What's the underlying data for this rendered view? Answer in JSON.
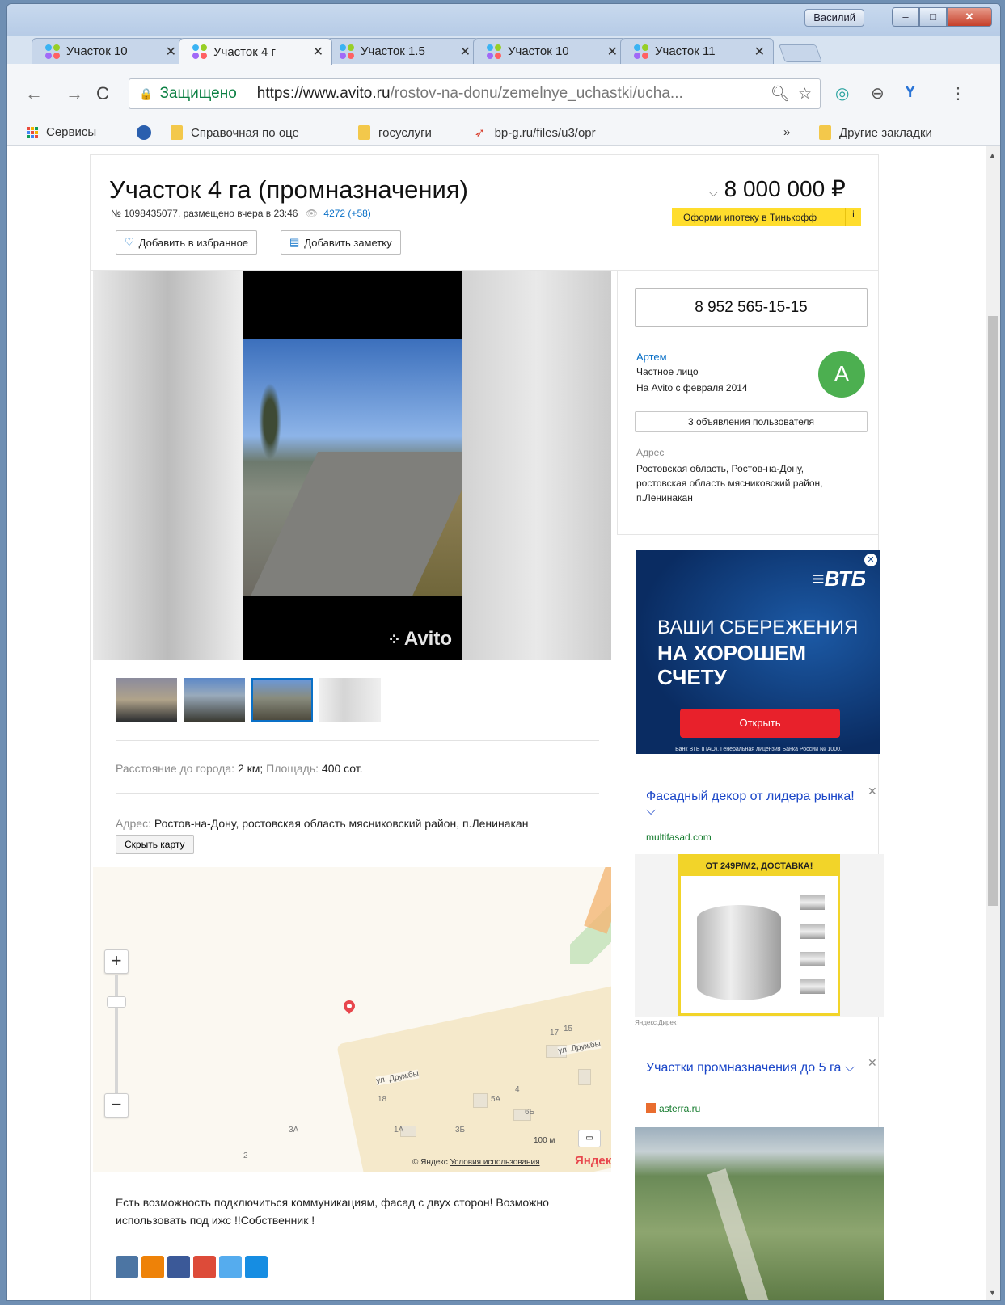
{
  "window": {
    "profile_name": "Василий"
  },
  "tabs": [
    {
      "title": "Участок 10"
    },
    {
      "title": "Участок 4 г",
      "active": true
    },
    {
      "title": "Участок 1.5"
    },
    {
      "title": "Участок 10"
    },
    {
      "title": "Участок 11"
    }
  ],
  "address_bar": {
    "secure_label": "Защищено",
    "url_host": "https://www.avito.ru",
    "url_path": "/rostov-na-donu/zemelnye_uchastki/ucha..."
  },
  "bookmarks": {
    "apps_label": "Сервисы",
    "items": [
      "Справочная по оце",
      "госуслуги",
      "bp-g.ru/files/u3/opr"
    ],
    "overflow": "»",
    "other_label": "Другие закладки"
  },
  "listing": {
    "title": "Участок 4 га (промназначения)",
    "meta_prefix": "№ 1098435077, размещено вчера в 23:46",
    "views": "4272 (+58)",
    "favorite_btn": "Добавить в избранное",
    "note_btn": "Добавить заметку",
    "price": "8 000 000 ₽",
    "mortgage_btn": "Оформи ипотеку в Тинькофф",
    "mortgage_info": "i",
    "watermark": "Avito",
    "distance_label": "Расстояние до города:",
    "distance_value": "2 км;",
    "area_label": "Площадь:",
    "area_value": "400 сот.",
    "address_label": "Адрес:",
    "address_value": "Ростов-на-Дону, ростовская область мясниковский район, п.Ленинакан",
    "hide_map_btn": "Скрыть карту",
    "description": "Есть возможность подключиться коммуникациям, фасад с двух сторон! Возможно использовать под ижс !!Собственник !"
  },
  "map": {
    "street1": "ул. Дружбы",
    "street2": "ул. Дружбы",
    "house_numbers": [
      "17",
      "15",
      "18",
      "4",
      "5А",
      "6Б",
      "3А",
      "1А",
      "3Б",
      "2"
    ],
    "scale": "100 м",
    "copyright": "© Яндекс",
    "terms": "Условия использования",
    "logo": "Яндекс"
  },
  "seller": {
    "phone": "8 952 565-15-15",
    "name": "Артем",
    "type": "Частное лицо",
    "since": "На Avito с февраля 2014",
    "avatar_letter": "А",
    "user_ads_btn": "3 объявления пользователя",
    "address_label": "Адрес",
    "address": "Ростовская область, Ростов-на-Дону, ростовская область мясниковский район, п.Ленинакан"
  },
  "ads": {
    "vtb": {
      "logo": "ВТБ",
      "line1": "ВАШИ СБЕРЕЖЕНИЯ",
      "line2": "НА ХОРОШЕМ",
      "line3": "СЧЕТУ",
      "button": "Открыть",
      "legal": "Банк ВТБ (ПАО). Генеральная лицензия Банка России № 1000."
    },
    "ad1": {
      "title": "Фасадный декор от лидера рынка! ⌵",
      "domain": "multifasad.com",
      "banner": "ОТ 249Р/М2, ДОСТАВКА!"
    },
    "direct_label": "Яндекс.Директ",
    "ad2": {
      "title": "Участки промназначения до 5 га ⌵",
      "domain": "asterra.ru"
    }
  },
  "colors": {
    "link": "#0a70c7",
    "mortgage_yellow": "#ffdd2d",
    "avatar_green": "#4caf50",
    "ad_title_blue": "#1a46c8"
  }
}
